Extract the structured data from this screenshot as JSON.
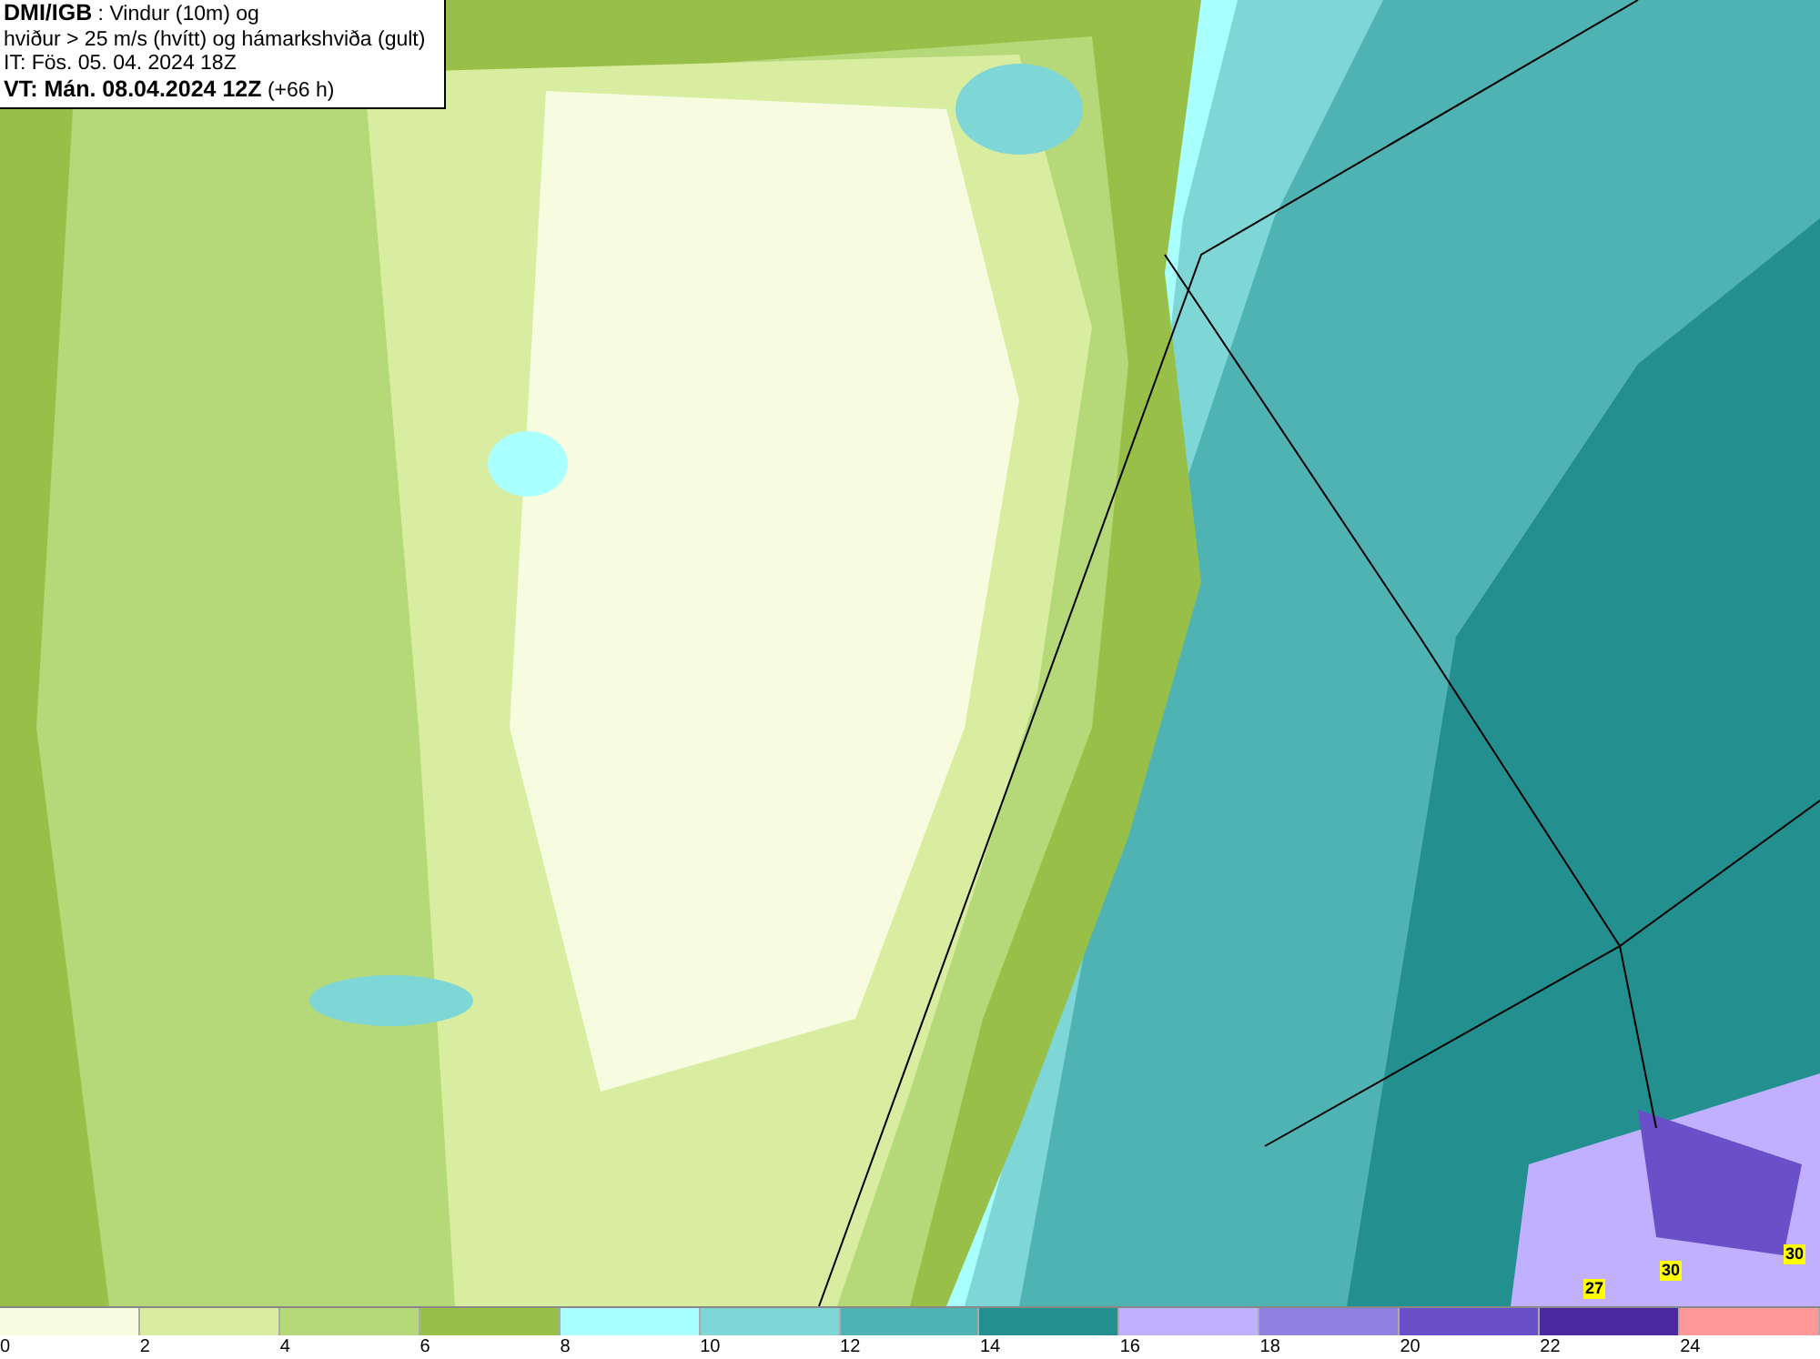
{
  "title_box": {
    "lines": [
      "**DMI/IGB** : Vindur (10m) og",
      "hviður > 25 m/s (hvítt) og hámarkshviða (gult)",
      "IT: Fös. 05. 04. 2024 18Z",
      "**VT: Mán. 08.04.2024 12Z** (+66 h)"
    ]
  },
  "gust_labels": [
    "27",
    "30",
    "30"
  ],
  "legend": {
    "swatches": [
      {
        "color": "#f7fbe0"
      },
      {
        "color": "#d9eda0"
      },
      {
        "color": "#b5d878"
      },
      {
        "color": "#98bf48"
      },
      {
        "color": "#aaffff"
      },
      {
        "color": "#7fd6d6"
      },
      {
        "color": "#50b3b3"
      },
      {
        "color": "#248f8f"
      },
      {
        "color": "#c0b0ff"
      },
      {
        "color": "#9080e0"
      },
      {
        "color": "#6a50c8"
      },
      {
        "color": "#4a28a0"
      },
      {
        "color": "#ff9898"
      }
    ],
    "ticks": [
      "0",
      "2",
      "4",
      "6",
      "8",
      "10",
      "12",
      "14",
      "16",
      "18",
      "20",
      "22",
      "24"
    ]
  }
}
